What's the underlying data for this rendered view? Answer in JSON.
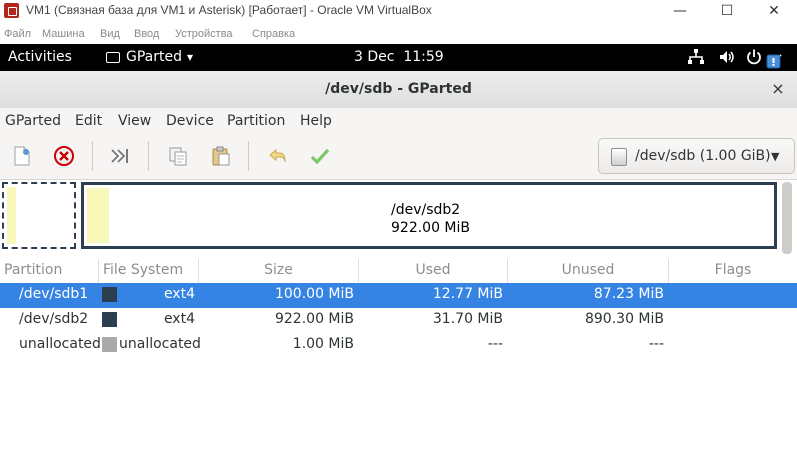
{
  "vbox": {
    "title": "VM1 (Связная база для VM1 и Asterisk) [Работает] - Oracle VM VirtualBox",
    "menu": [
      "Файл",
      "Машина",
      "Вид",
      "Ввод",
      "Устройства",
      "Справка"
    ],
    "controls": {
      "minimize": "—",
      "maximize": "☐",
      "close": "✕"
    }
  },
  "topbar": {
    "activities": "Activities",
    "app_name": "GParted",
    "app_caret": "▾",
    "clock": "3 Dec  11:59"
  },
  "window": {
    "title": "/dev/sdb - GParted",
    "close": "×"
  },
  "menubar": [
    "GParted",
    "Edit",
    "View",
    "Device",
    "Partition",
    "Help"
  ],
  "toolbar": {
    "device_label": "/dev/sdb (1.00 GiB)",
    "device_arrow": "▼"
  },
  "visual": {
    "selected_partition": {
      "name": "/dev/sdb2",
      "size": "922.00 MiB"
    }
  },
  "table": {
    "columns": [
      "Partition",
      "File System",
      "Size",
      "Used",
      "Unused",
      "Flags"
    ],
    "rows": [
      {
        "partition": "/dev/sdb1",
        "fs": "ext4",
        "fs_color": "#2c3e50",
        "size": "100.00 MiB",
        "used": "12.77 MiB",
        "unused": "87.23 MiB",
        "flags": "",
        "selected": true
      },
      {
        "partition": "/dev/sdb2",
        "fs": "ext4",
        "fs_color": "#2c3e50",
        "size": "922.00 MiB",
        "used": "31.70 MiB",
        "unused": "890.30 MiB",
        "flags": "",
        "selected": false
      },
      {
        "partition": "unallocated",
        "fs": "unallocated",
        "fs_color": "#a9a9a9",
        "size": "1.00 MiB",
        "used": "---",
        "unused": "---",
        "flags": "",
        "selected": false
      }
    ]
  },
  "colors": {
    "selection": "#3584e4",
    "ext4": "#2c3e50",
    "unallocated": "#a9a9a9",
    "used_space": "#f8f8ba"
  }
}
